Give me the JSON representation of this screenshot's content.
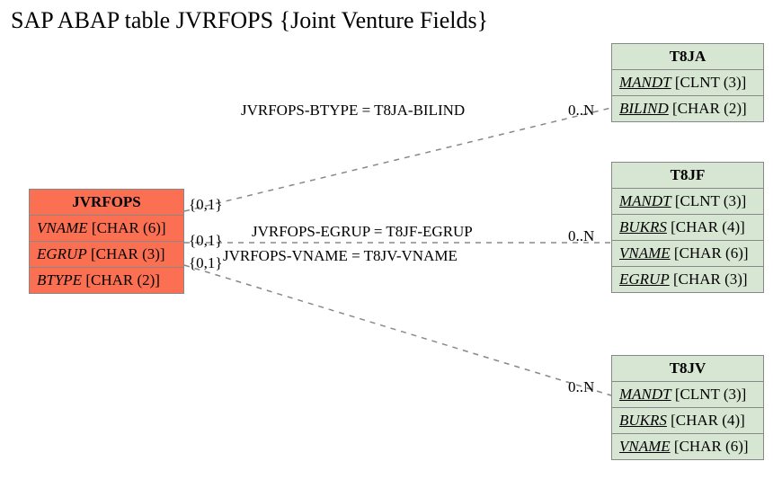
{
  "title": "SAP ABAP table JVRFOPS {Joint Venture Fields}",
  "entities": {
    "main": {
      "name": "JVRFOPS",
      "fields": [
        {
          "name": "VNAME",
          "type": "[CHAR (6)]"
        },
        {
          "name": "EGRUP",
          "type": "[CHAR (3)]"
        },
        {
          "name": "BTYPE",
          "type": "[CHAR (2)]"
        }
      ]
    },
    "t8ja": {
      "name": "T8JA",
      "fields": [
        {
          "name": "MANDT",
          "type": "[CLNT (3)]"
        },
        {
          "name": "BILIND",
          "type": "[CHAR (2)]"
        }
      ]
    },
    "t8jf": {
      "name": "T8JF",
      "fields": [
        {
          "name": "MANDT",
          "type": "[CLNT (3)]"
        },
        {
          "name": "BUKRS",
          "type": "[CHAR (4)]"
        },
        {
          "name": "VNAME",
          "type": "[CHAR (6)]"
        },
        {
          "name": "EGRUP",
          "type": "[CHAR (3)]"
        }
      ]
    },
    "t8jv": {
      "name": "T8JV",
      "fields": [
        {
          "name": "MANDT",
          "type": "[CLNT (3)]"
        },
        {
          "name": "BUKRS",
          "type": "[CHAR (4)]"
        },
        {
          "name": "VNAME",
          "type": "[CHAR (6)]"
        }
      ]
    }
  },
  "relations": {
    "r1": {
      "label": "JVRFOPS-BTYPE = T8JA-BILIND",
      "leftCard": "{0,1}",
      "rightCard": "0..N"
    },
    "r2": {
      "label": "JVRFOPS-EGRUP = T8JF-EGRUP",
      "leftCard": "{0,1}",
      "rightCard": "0..N"
    },
    "r3": {
      "label": "JVRFOPS-VNAME = T8JV-VNAME",
      "leftCard": "{0,1}",
      "rightCard": "0..N"
    }
  },
  "chart_data": {
    "type": "table",
    "description": "Entity-relationship diagram for SAP ABAP table JVRFOPS (Joint Venture Fields) and related tables T8JA, T8JF, T8JV.",
    "entities": [
      {
        "name": "JVRFOPS",
        "fields": [
          "VNAME CHAR(6)",
          "EGRUP CHAR(3)",
          "BTYPE CHAR(2)"
        ]
      },
      {
        "name": "T8JA",
        "fields": [
          "MANDT CLNT(3)",
          "BILIND CHAR(2)"
        ]
      },
      {
        "name": "T8JF",
        "fields": [
          "MANDT CLNT(3)",
          "BUKRS CHAR(4)",
          "VNAME CHAR(6)",
          "EGRUP CHAR(3)"
        ]
      },
      {
        "name": "T8JV",
        "fields": [
          "MANDT CLNT(3)",
          "BUKRS CHAR(4)",
          "VNAME CHAR(6)"
        ]
      }
    ],
    "relationships": [
      {
        "from": "JVRFOPS.BTYPE",
        "to": "T8JA.BILIND",
        "fromCard": "{0,1}",
        "toCard": "0..N"
      },
      {
        "from": "JVRFOPS.EGRUP",
        "to": "T8JF.EGRUP",
        "fromCard": "{0,1}",
        "toCard": "0..N"
      },
      {
        "from": "JVRFOPS.VNAME",
        "to": "T8JV.VNAME",
        "fromCard": "{0,1}",
        "toCard": "0..N"
      }
    ]
  }
}
